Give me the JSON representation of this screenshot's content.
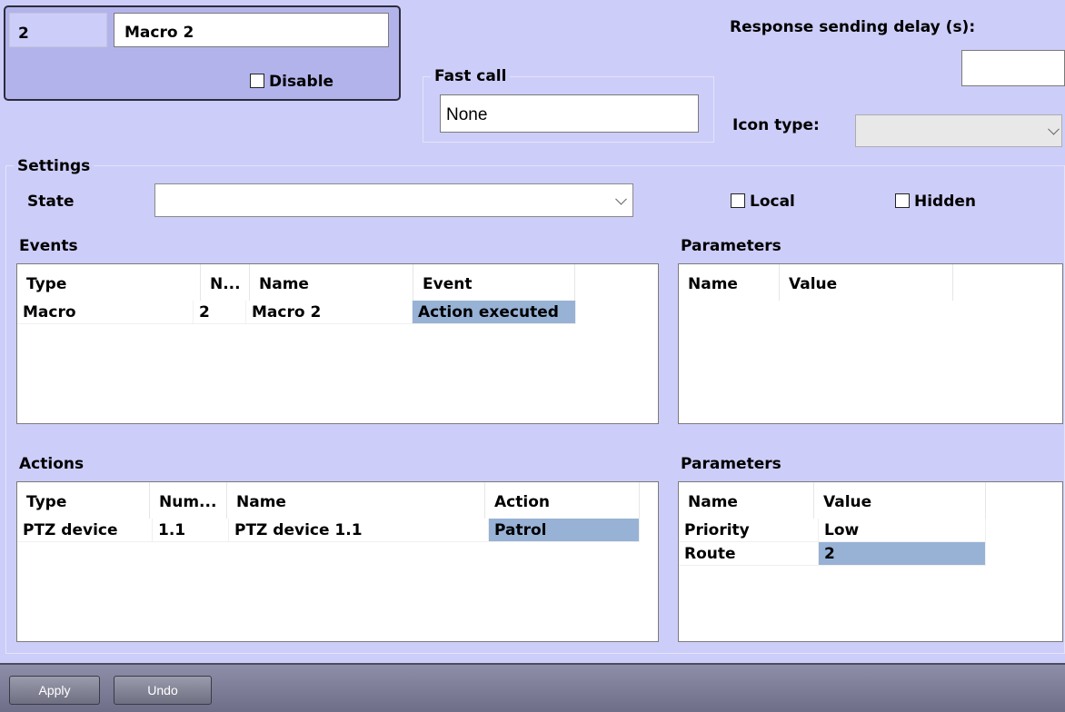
{
  "object": {
    "id": "2",
    "name": "Macro 2",
    "disable_label": "Disable"
  },
  "fast_call": {
    "label": "Fast call",
    "value": "None"
  },
  "response_delay": {
    "label": "Response sending delay (s):",
    "value": ""
  },
  "icon_type": {
    "label": "Icon type:",
    "value": ""
  },
  "settings": {
    "label": "Settings",
    "state_label": "State",
    "state_value": "",
    "local_label": "Local",
    "hidden_label": "Hidden"
  },
  "events": {
    "label": "Events",
    "columns": [
      "Type",
      "N...",
      "Name",
      "Event"
    ],
    "rows": [
      [
        "Macro",
        "2",
        "Macro 2",
        "Action executed"
      ]
    ]
  },
  "event_params": {
    "label": "Parameters",
    "columns": [
      "Name",
      "Value"
    ],
    "rows": []
  },
  "actions": {
    "label": "Actions",
    "columns": [
      "Type",
      "Num...",
      "Name",
      "Action"
    ],
    "rows": [
      [
        "PTZ device",
        "1.1",
        "PTZ device 1.1",
        "Patrol"
      ]
    ]
  },
  "action_params": {
    "label": "Parameters",
    "columns": [
      "Name",
      "Value"
    ],
    "rows": [
      [
        "Priority",
        "Low"
      ],
      [
        "Route",
        "2"
      ]
    ]
  },
  "buttons": {
    "apply": "Apply",
    "undo": "Undo"
  },
  "colors": {
    "background": "#cdcdf9",
    "selection": "#98b2d6",
    "bottom_bar": "#7e7e98"
  }
}
